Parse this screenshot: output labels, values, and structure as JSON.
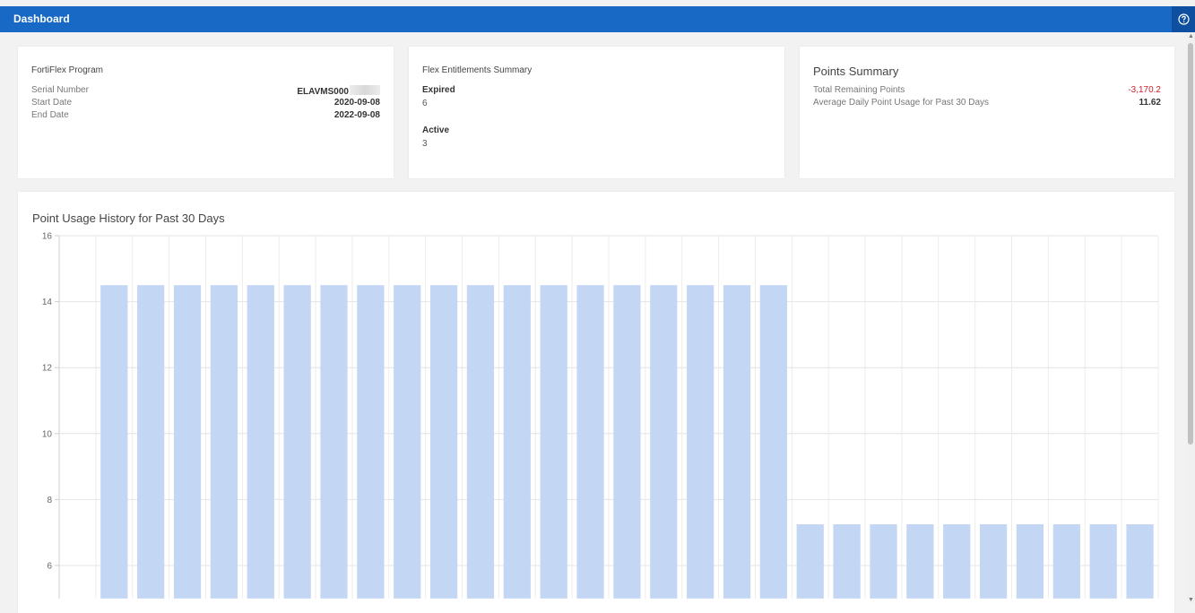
{
  "header": {
    "title": "Dashboard",
    "help_icon": "help-circle-icon"
  },
  "program": {
    "title": "FortiFlex Program",
    "rows": [
      {
        "label": "Serial Number",
        "value": "ELAVMS000"
      },
      {
        "label": "Start Date",
        "value": "2020-09-08"
      },
      {
        "label": "End Date",
        "value": "2022-09-08"
      }
    ]
  },
  "entitlements": {
    "title": "Flex Entitlements Summary",
    "expired_label": "Expired",
    "expired_value": "6",
    "active_label": "Active",
    "active_value": "3"
  },
  "points": {
    "title": "Points Summary",
    "rows": [
      {
        "label": "Total Remaining Points",
        "value": "-3,170.2"
      },
      {
        "label": "Average Daily Point Usage for Past 30 Days",
        "value": "11.62"
      }
    ],
    "negative_color": "#d0202d"
  },
  "chart_data": {
    "type": "bar",
    "title": "Point Usage History for Past 30 Days",
    "xlabel": "",
    "ylabel": "",
    "yticks": [
      6,
      8,
      10,
      12,
      14,
      16
    ],
    "ylim": [
      5,
      16
    ],
    "grid": true,
    "bar_color": "#c3d6f3",
    "values": [
      null,
      14.5,
      14.5,
      14.5,
      14.5,
      14.5,
      14.5,
      14.5,
      14.5,
      14.5,
      14.5,
      14.5,
      14.5,
      14.5,
      14.5,
      14.5,
      14.5,
      14.5,
      14.5,
      14.5,
      7.25,
      7.25,
      7.25,
      7.25,
      7.25,
      7.25,
      7.25,
      7.25,
      7.25,
      7.25
    ]
  }
}
